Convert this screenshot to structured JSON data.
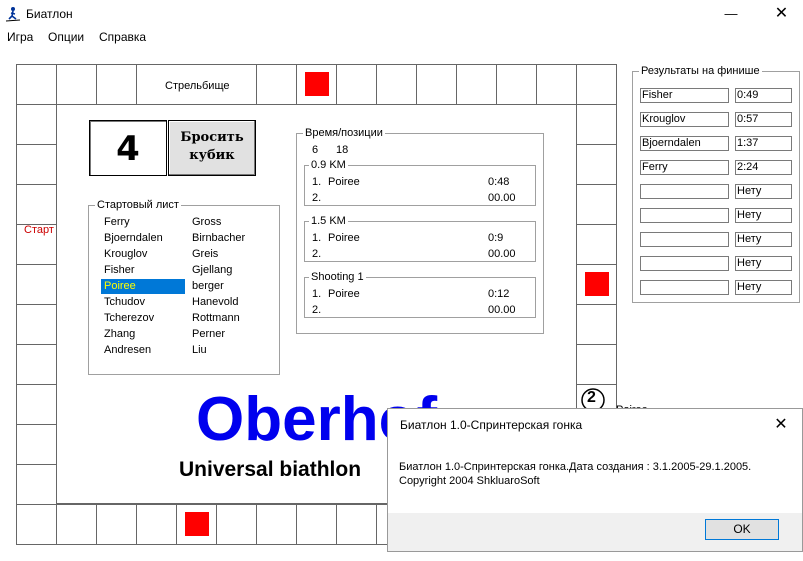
{
  "window": {
    "title": "Биатлон",
    "minimize_glyph": "—",
    "close_glyph": "✕"
  },
  "menu": [
    "Игра",
    "Опции",
    "Справка"
  ],
  "board": {
    "shooting_range_label": "Стрельбище",
    "start_label": "Старт",
    "dice_value": "4",
    "roll_button_line1": "Бросить",
    "roll_button_line2": "кубик",
    "marker_number": "2",
    "marker_name": "Poiree",
    "start_label_color": "#cc0000",
    "marker_color": "#ff0000"
  },
  "start_list": {
    "title": "Стартовый лист",
    "selected": "Poiree",
    "left_column": [
      "Ferry",
      "Bjoerndalen",
      "Krouglov",
      "Fisher",
      "Poiree",
      "Tchudov",
      "Tcherezov",
      "Zhang",
      "Andresen"
    ],
    "right_column": [
      "Gross",
      "Birnbacher",
      "Greis",
      "Gjellang",
      "berger",
      "Hanevold",
      "Rottmann",
      "Perner",
      "Liu"
    ]
  },
  "times": {
    "title": "Время/позиции",
    "header_a": "6",
    "header_b": "18",
    "sections": [
      {
        "title": "0.9 KM",
        "rows": [
          {
            "pos": "1.",
            "name": "Poiree",
            "time": "0:48"
          },
          {
            "pos": "2.",
            "name": "",
            "time": "00.00"
          }
        ]
      },
      {
        "title": "1.5 KM",
        "rows": [
          {
            "pos": "1.",
            "name": "Poiree",
            "time": "0:9"
          },
          {
            "pos": "2.",
            "name": "",
            "time": "00.00"
          }
        ]
      },
      {
        "title": "Shooting 1",
        "rows": [
          {
            "pos": "1.",
            "name": "Poiree",
            "time": "0:12"
          },
          {
            "pos": "2.",
            "name": "",
            "time": "00.00"
          }
        ]
      }
    ]
  },
  "results": {
    "title": "Результаты на финише",
    "rows": [
      {
        "name": "Fisher",
        "time": "0:49"
      },
      {
        "name": "Krouglov",
        "time": "0:57"
      },
      {
        "name": "Bjoerndalen",
        "time": "1:37"
      },
      {
        "name": "Ferry",
        "time": "2:24"
      },
      {
        "name": "",
        "time": "Нету"
      },
      {
        "name": "",
        "time": "Нету"
      },
      {
        "name": "",
        "time": "Нету"
      },
      {
        "name": "",
        "time": "Нету"
      },
      {
        "name": "",
        "time": "Нету"
      }
    ]
  },
  "logo": {
    "title": "Oberhof",
    "subtitle": "Universal biathlon"
  },
  "dialog": {
    "title": "Биатлон 1.0-Спринтерская гонка",
    "close_glyph": "✕",
    "line1": "Биатлон 1.0-Спринтерская гонка.Дата создания : 3.1.2005-29.1.2005.",
    "line2": "Copyright 2004 ShkluaroSoft",
    "ok_label": "OK"
  }
}
